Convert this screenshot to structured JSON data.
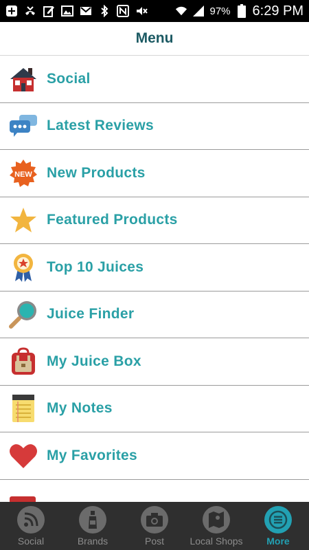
{
  "status_bar": {
    "battery": "97%",
    "time": "6:29 PM"
  },
  "header": {
    "title": "Menu"
  },
  "menu": {
    "items": [
      {
        "label": "Social",
        "icon": "house-icon"
      },
      {
        "label": "Latest Reviews",
        "icon": "chat-bubbles-icon"
      },
      {
        "label": "New Products",
        "icon": "new-badge-icon"
      },
      {
        "label": "Featured Products",
        "icon": "star-icon"
      },
      {
        "label": "Top 10 Juices",
        "icon": "award-ribbon-icon"
      },
      {
        "label": "Juice Finder",
        "icon": "magnifier-icon"
      },
      {
        "label": "My Juice Box",
        "icon": "backpack-icon"
      },
      {
        "label": "My Notes",
        "icon": "notepad-icon"
      },
      {
        "label": "My Favorites",
        "icon": "heart-icon"
      }
    ]
  },
  "tab_bar": {
    "tabs": [
      {
        "label": "Social",
        "icon": "rss-icon",
        "active": false
      },
      {
        "label": "Brands",
        "icon": "bottle-icon",
        "active": false
      },
      {
        "label": "Post",
        "icon": "camera-icon",
        "active": false
      },
      {
        "label": "Local Shops",
        "icon": "map-icon",
        "active": false
      },
      {
        "label": "More",
        "icon": "menu-lines-icon",
        "active": true
      }
    ]
  },
  "colors": {
    "accent": "#2aa0a6",
    "header_title": "#1c5a63",
    "tab_active": "#22a1b3",
    "tab_bar_bg": "#2f2f2f"
  }
}
